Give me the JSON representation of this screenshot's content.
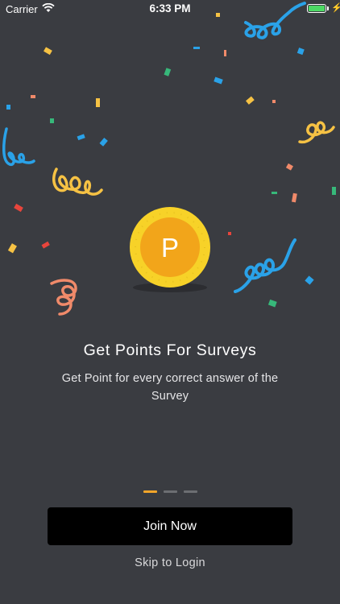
{
  "status_bar": {
    "carrier": "Carrier",
    "time": "6:33 PM",
    "wifi_icon": "wifi-icon",
    "battery_icon": "battery-icon",
    "charging_icon": "lightning-bolt-icon",
    "battery_color": "#4cd964"
  },
  "coin": {
    "letter": "P",
    "icon": "coin-icon",
    "colors": {
      "rim": "#f7d228",
      "face": "#f2a51a",
      "shadow": "#2c2d31"
    }
  },
  "onboarding": {
    "title": "Get Points For Surveys",
    "subtitle": "Get Point for every correct answer of the Survey",
    "page_indicator": {
      "total": 3,
      "active": 0
    }
  },
  "actions": {
    "join_label": "Join Now",
    "skip_label": "Skip to Login"
  },
  "theme": {
    "background": "#3a3c41",
    "accent": "#f2a52a",
    "confetti_colors": [
      "#2aa2e8",
      "#f6c244",
      "#f08a6a",
      "#e8453c",
      "#37b87a"
    ]
  }
}
